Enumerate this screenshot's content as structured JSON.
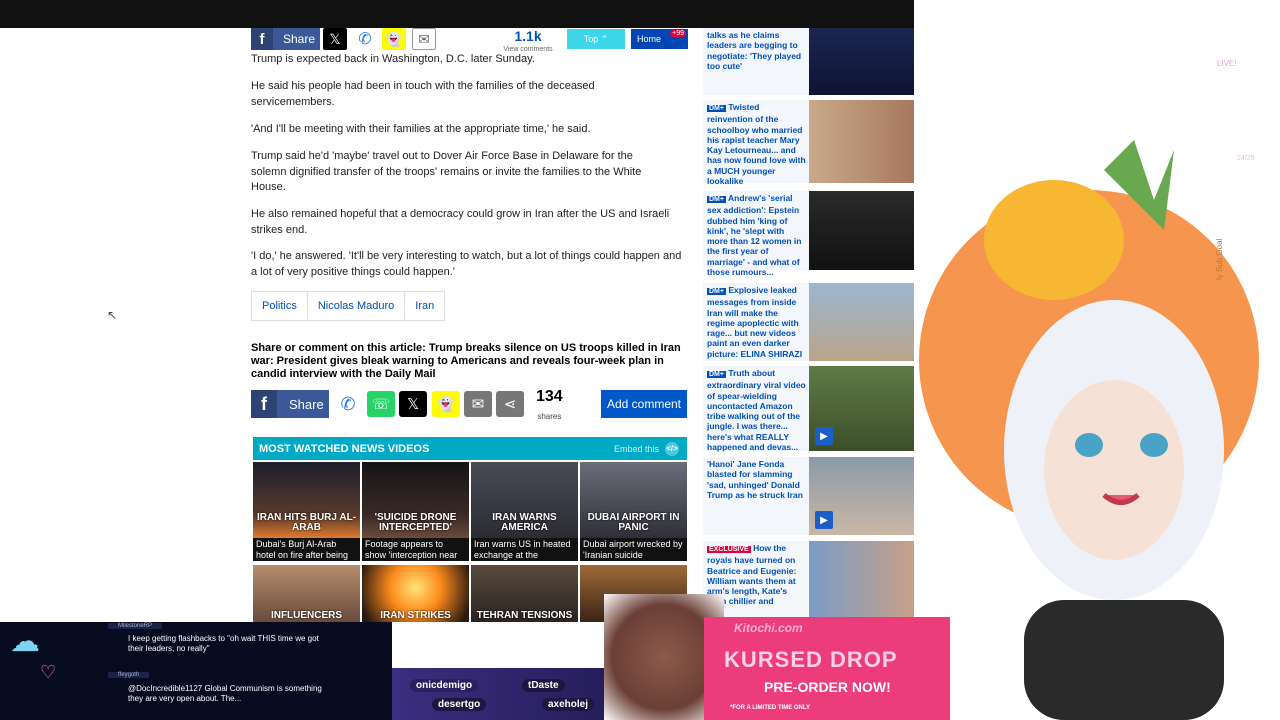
{
  "sharebar": {
    "share_label": "Share",
    "comments_count": "1.1k",
    "comments_sub": "View comments",
    "top_label": "Top",
    "home_label": "Home",
    "home_badge": "+99"
  },
  "article": {
    "paragraphs": [
      "Trump is expected back in Washington, D.C. later Sunday.",
      "He said his people had been in touch with the families of the deceased servicemembers.",
      "'And I'll be meeting with their families at the appropriate time,' he said.",
      "Trump said he'd 'maybe' travel out to Dover Air Force Base in Delaware for the solemn dignified transfer of the troops' remains or invite the families to the White House.",
      "He also remained hopeful that a democracy could grow in Iran after the US and Israeli strikes end.",
      "'I do,' he answered. 'It'll be very interesting to watch, but a lot of things could happen and a lot of very positive things could happen.'"
    ],
    "tags": [
      "Politics",
      "Nicolas Maduro",
      "Iran"
    ],
    "share_heading": "Share or comment on this article: Trump breaks silence on US troops killed in Iran war: President gives bleak warning to Americans and reveals four-week plan in candid interview with the Daily Mail",
    "share_label": "Share",
    "shares_count": "134",
    "shares_label": "shares",
    "add_comment_label": "Add comment"
  },
  "most_watched": {
    "heading": "MOST WATCHED NEWS VIDEOS",
    "embed_label": "Embed this",
    "videos": [
      {
        "overlay": "IRAN HITS BURJ AL-ARAB",
        "caption": "Dubai's Burj Al-Arab hotel on fire after being"
      },
      {
        "overlay": "'SUICIDE DRONE INTERCEPTED'",
        "caption": "Footage appears to show 'interception near"
      },
      {
        "overlay": "IRAN WARNS AMERICA",
        "caption": "Iran warns US in heated exchange at the"
      },
      {
        "overlay": "DUBAI AIRPORT IN PANIC",
        "caption": "Dubai airport wrecked by 'Iranian suicide"
      },
      {
        "overlay": "INFLUENCERS",
        "caption": ""
      },
      {
        "overlay": "IRAN STRIKES",
        "caption": ""
      },
      {
        "overlay": "TEHRAN TENSIONS",
        "caption": ""
      },
      {
        "overlay": "",
        "caption": ""
      }
    ]
  },
  "sidebar": {
    "items": [
      {
        "badge": "",
        "text": "talks as he claims leaders are begging to negotiate: 'They played too cute'"
      },
      {
        "badge": "DM+",
        "text": "Twisted reinvention of the schoolboy who married his rapist teacher Mary Kay Letourneau... and has now found love with a MUCH younger lookalike"
      },
      {
        "badge": "DM+",
        "text": "Andrew's 'serial sex addiction': Epstein dubbed him 'king of kink', he 'slept with more than 12 women in the first year of marriage' - and what of those rumours..."
      },
      {
        "badge": "DM+",
        "text": "Explosive leaked messages from inside Iran will make the regime apoplectic with rage... but new videos paint an even darker picture: ELINA SHIRAZI"
      },
      {
        "badge": "DM+",
        "text": "Truth about extraordinary viral video of spear-wielding uncontacted Amazon tribe walking out of the jungle. I was there... here's what REALLY happened and devas..."
      },
      {
        "badge": "",
        "text": "'Hanoi' Jane Fonda blasted for slamming 'sad, unhinged' Donald Trump as he struck Iran"
      },
      {
        "badge": "EXCLUSIVE",
        "text": "How the royals have turned on Beatrice and Eugenie: William wants them at arm's length, Kate's even chillier and"
      }
    ]
  },
  "stream": {
    "chat": [
      {
        "user": "MilestoneRP",
        "text": "I keep getting flashbacks to \"oh wait THIS time we got their leaders, no really\""
      },
      {
        "user": "ffeygoth",
        "text": "@DocIncredible1127 Global Communism is something they are very open about. The..."
      }
    ],
    "subs": [
      "onicdemigo",
      "tDaste",
      "desertgo",
      "axeholej"
    ],
    "promo_brand": "Kitochi.com",
    "promo_title": "KURSED DROP",
    "promo_sub": "PRE-ORDER NOW!",
    "promo_tiny": "*FOR A LIMITED TIME ONLY",
    "live_label": "LIVE!",
    "goal_label": "ly Sub Goal",
    "goal_count": "24/25"
  }
}
